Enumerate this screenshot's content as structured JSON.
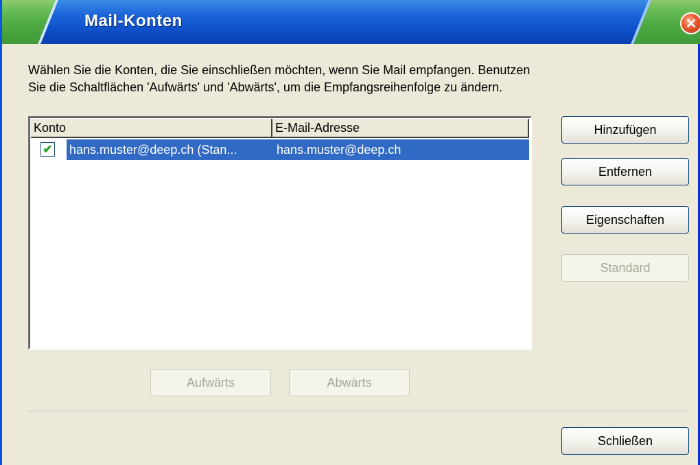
{
  "window": {
    "title": "Mail-Konten"
  },
  "instructions": {
    "line1": "Wählen Sie die Konten, die Sie einschließen möchten, wenn Sie Mail empfangen. Benutzen",
    "line2": "Sie die Schaltflächen 'Aufwärts' und 'Abwärts', um die Empfangsreihenfolge zu ändern."
  },
  "accounts": {
    "columns": [
      "Konto",
      "E-Mail-Adresse"
    ],
    "rows": [
      {
        "checked": true,
        "account": "hans.muster@deep.ch (Stan...",
        "email": "hans.muster@deep.ch",
        "selected": true
      }
    ]
  },
  "buttons": {
    "add": "Hinzufügen",
    "remove": "Entfernen",
    "properties": "Eigenschaften",
    "default": "Standard",
    "up": "Aufwärts",
    "down": "Abwärts",
    "close": "Schließen"
  },
  "colors": {
    "selection": "#316ac5",
    "dialog_background": "#ece9d8",
    "title_blue": "#0c4cc4",
    "title_green": "#4faa43",
    "close_red": "#e8562a"
  },
  "icons": {
    "close": "close-icon",
    "checkbox": "checkmark-icon"
  }
}
